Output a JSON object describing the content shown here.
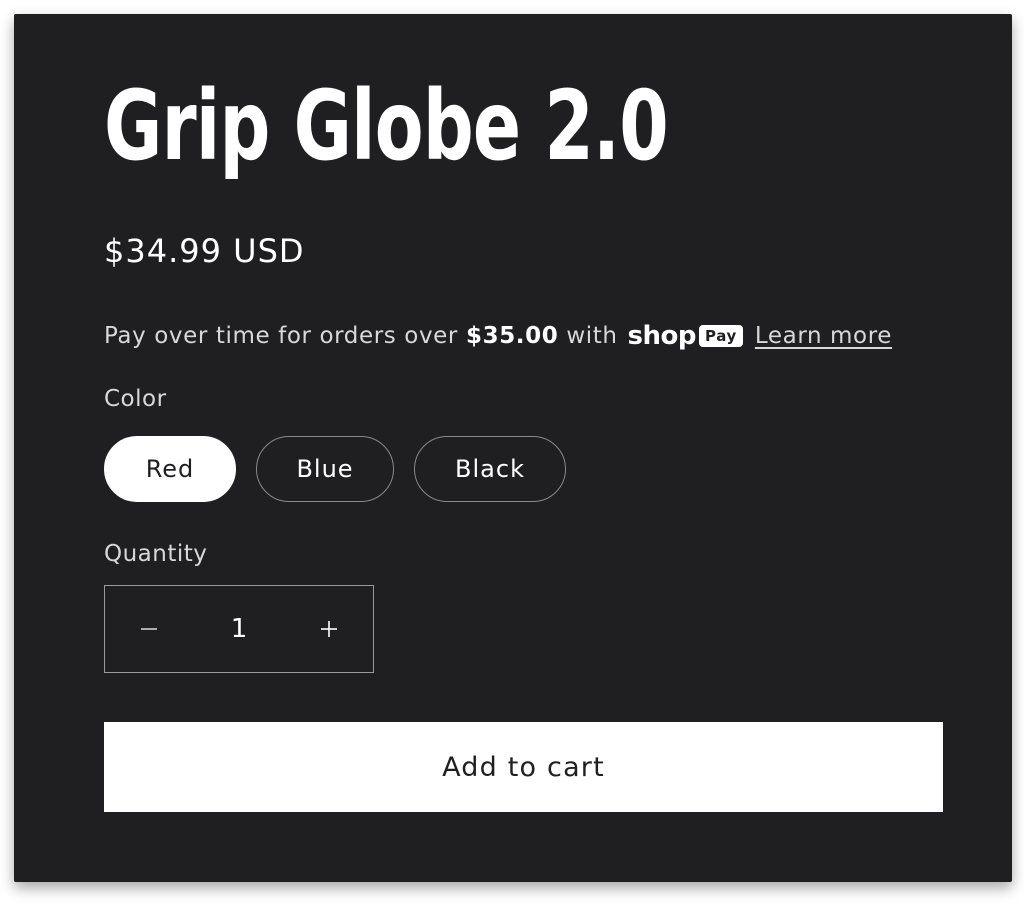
{
  "product": {
    "title": "Grip Globe 2.0",
    "price": "$34.99 USD"
  },
  "installments": {
    "prefix": "Pay over time for orders over",
    "threshold": "$35.00",
    "with_text": "with",
    "shop_logo": "shop",
    "pay_badge": "Pay",
    "learn_more": "Learn more"
  },
  "color": {
    "label": "Color",
    "options": [
      "Red",
      "Blue",
      "Black"
    ],
    "selected": "Red"
  },
  "quantity": {
    "label": "Quantity",
    "value": "1",
    "decrease_icon": "minus-icon",
    "increase_icon": "plus-icon"
  },
  "cart": {
    "add_label": "Add to cart"
  },
  "colors": {
    "card_background": "#1f1f21",
    "text_primary": "#ffffff",
    "text_secondary": "#d8d8d8",
    "button_background": "#ffffff"
  }
}
